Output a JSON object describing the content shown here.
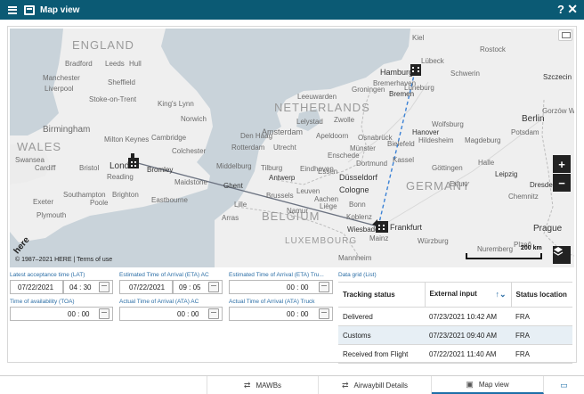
{
  "window": {
    "title": "Map view",
    "help_label": "?",
    "close_label": "✕"
  },
  "map": {
    "countries": [
      "ENGLAND",
      "WALES",
      "NETHERLANDS",
      "BELGIUM",
      "GERMANY",
      "LUXEMBOURG"
    ],
    "cities": [
      {
        "name": "Bradford"
      },
      {
        "name": "Leeds"
      },
      {
        "name": "Hull"
      },
      {
        "name": "Manchester"
      },
      {
        "name": "Liverpool"
      },
      {
        "name": "Sheffield"
      },
      {
        "name": "Stoke-on-Trent"
      },
      {
        "name": "King's Lynn"
      },
      {
        "name": "Norwich"
      },
      {
        "name": "Birmingham"
      },
      {
        "name": "Milton Keynes"
      },
      {
        "name": "Cambridge"
      },
      {
        "name": "Colchester"
      },
      {
        "name": "Swansea"
      },
      {
        "name": "Cardiff"
      },
      {
        "name": "Bristol"
      },
      {
        "name": "London"
      },
      {
        "name": "Bromley"
      },
      {
        "name": "Reading"
      },
      {
        "name": "Maidstone"
      },
      {
        "name": "Southampton"
      },
      {
        "name": "Brighton"
      },
      {
        "name": "Exeter"
      },
      {
        "name": "Poole"
      },
      {
        "name": "Eastbourne"
      },
      {
        "name": "Plymouth"
      },
      {
        "name": "Amsterdam"
      },
      {
        "name": "Leeuwarden"
      },
      {
        "name": "Groningen"
      },
      {
        "name": "Lelystad"
      },
      {
        "name": "Zwolle"
      },
      {
        "name": "Apeldoorn"
      },
      {
        "name": "Utrecht"
      },
      {
        "name": "Rotterdam"
      },
      {
        "name": "Den Haag"
      },
      {
        "name": "Enschede"
      },
      {
        "name": "Middelburg"
      },
      {
        "name": "Tilburg"
      },
      {
        "name": "Eindhoven"
      },
      {
        "name": "Ghent"
      },
      {
        "name": "Antwerp"
      },
      {
        "name": "Brussels"
      },
      {
        "name": "Leuven"
      },
      {
        "name": "Liège"
      },
      {
        "name": "Namur"
      },
      {
        "name": "Aachen"
      },
      {
        "name": "Bonn"
      },
      {
        "name": "Arras"
      },
      {
        "name": "Lille"
      },
      {
        "name": "Dortmund"
      },
      {
        "name": "Essen"
      },
      {
        "name": "Düsseldorf"
      },
      {
        "name": "Cologne"
      },
      {
        "name": "Münster"
      },
      {
        "name": "Bielefeld"
      },
      {
        "name": "Osnabrück"
      },
      {
        "name": "Bremerhaven"
      },
      {
        "name": "Bremen"
      },
      {
        "name": "Hamburg"
      },
      {
        "name": "Lübeck"
      },
      {
        "name": "Kiel"
      },
      {
        "name": "Rostock"
      },
      {
        "name": "Schwerin"
      },
      {
        "name": "Lüneburg"
      },
      {
        "name": "Hanover"
      },
      {
        "name": "Wolfsburg"
      },
      {
        "name": "Hildesheim"
      },
      {
        "name": "Magdeburg"
      },
      {
        "name": "Berlin"
      },
      {
        "name": "Potsdam"
      },
      {
        "name": "Halle"
      },
      {
        "name": "Leipzig"
      },
      {
        "name": "Dresden"
      },
      {
        "name": "Chemnitz"
      },
      {
        "name": "Kassel"
      },
      {
        "name": "Göttingen"
      },
      {
        "name": "Erfurt"
      },
      {
        "name": "Koblenz"
      },
      {
        "name": "Wiesbaden"
      },
      {
        "name": "Frankfurt"
      },
      {
        "name": "Mainz"
      },
      {
        "name": "Würzburg"
      },
      {
        "name": "Nuremberg"
      },
      {
        "name": "Mannheim"
      },
      {
        "name": "Prague"
      },
      {
        "name": "Plzeň"
      },
      {
        "name": "Szczecin"
      },
      {
        "name": "Gorzów Wlkp."
      }
    ],
    "scale_label": "200 km",
    "copyright": "© 1987–2021 HERE | Terms of use",
    "logo_text": "here",
    "zoom_in_label": "+",
    "zoom_out_label": "−"
  },
  "form": {
    "lat": {
      "label": "Latest acceptance time (LAT)",
      "date": "07/22/2021",
      "time": "04 : 30"
    },
    "eta_ac": {
      "label": "Estimated Time of Arrival (ETA) AC",
      "date": "07/22/2021",
      "time": "09 : 05"
    },
    "eta_truck": {
      "label": "Estimated Time of Arrival (ETA) Tru...",
      "time": "00 : 00"
    },
    "toa": {
      "label": "Time of availability (TOA)",
      "time": "00 : 00"
    },
    "ata_ac": {
      "label": "Actual Time of Arrival (ATA) AC",
      "time": "00 : 00"
    },
    "ata_truck": {
      "label": "Actual Time of Arrival (ATA) Truck",
      "time": "00 : 00"
    }
  },
  "grid": {
    "title": "Data grid (List)",
    "columns": [
      "Tracking status",
      "External input",
      "Status location"
    ],
    "rows": [
      {
        "status": "Delivered",
        "input": "07/23/2021 10:42 AM",
        "location": "FRA"
      },
      {
        "status": "Customs",
        "input": "07/23/2021 09:40 AM",
        "location": "FRA"
      },
      {
        "status": "Received from Flight",
        "input": "07/22/2021 11:40 AM",
        "location": "FRA"
      }
    ]
  },
  "tabs": [
    {
      "label": "MAWBs",
      "active": false
    },
    {
      "label": "Airwaybill Details",
      "active": false
    },
    {
      "label": "Map view",
      "active": true
    }
  ],
  "colors": {
    "header": "#0b5a74",
    "accent": "#2b6ea6",
    "route_solid": "#6b7280",
    "route_dashed": "#3b82d6"
  }
}
